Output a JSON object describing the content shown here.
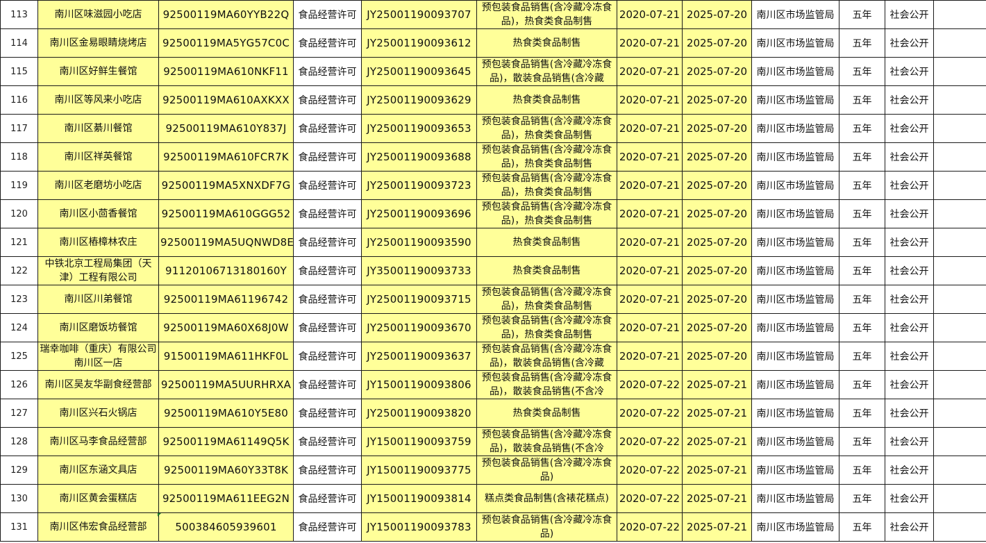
{
  "rows": [
    {
      "no": "113",
      "name": "南川区味滋园小吃店",
      "code": "92500119MA60YYB22Q",
      "type": "食品经营许可",
      "license": "JY25001190093707",
      "scope": "预包装食品销售(含冷藏冷冻食品)，热食类食品制售",
      "start": "2020-07-21",
      "end": "2025-07-20",
      "authority": "南川区市场监管局",
      "term": "五年",
      "publicity": "社会公开"
    },
    {
      "no": "114",
      "name": "南川区金易眼睛烧烤店",
      "code": "92500119MA5YG57C0C",
      "type": "食品经营许可",
      "license": "JY25001190093612",
      "scope": "热食类食品制售",
      "start": "2020-07-21",
      "end": "2025-07-20",
      "authority": "南川区市场监管局",
      "term": "五年",
      "publicity": "社会公开"
    },
    {
      "no": "115",
      "name": "南川区好鲜生餐馆",
      "code": "92500119MA610NKF11",
      "type": "食品经营许可",
      "license": "JY25001190093645",
      "scope": "预包装食品销售(含冷藏冷冻食品)，散装食品销售(含冷藏",
      "start": "2020-07-21",
      "end": "2025-07-20",
      "authority": "南川区市场监管局",
      "term": "五年",
      "publicity": "社会公开"
    },
    {
      "no": "116",
      "name": "南川区等风来小吃店",
      "code": "92500119MA610AXKXX",
      "type": "食品经营许可",
      "license": "JY25001190093629",
      "scope": "热食类食品制售",
      "start": "2020-07-21",
      "end": "2025-07-20",
      "authority": "南川区市场监管局",
      "term": "五年",
      "publicity": "社会公开"
    },
    {
      "no": "117",
      "name": "南川区綦川餐馆",
      "code": "92500119MA610Y837J",
      "type": "食品经营许可",
      "license": "JY25001190093653",
      "scope": "预包装食品销售(含冷藏冷冻食品)，热食类食品制售",
      "start": "2020-07-21",
      "end": "2025-07-20",
      "authority": "南川区市场监管局",
      "term": "五年",
      "publicity": "社会公开"
    },
    {
      "no": "118",
      "name": "南川区祥英餐馆",
      "code": "92500119MA610FCR7K",
      "type": "食品经营许可",
      "license": "JY25001190093688",
      "scope": "预包装食品销售(含冷藏冷冻食品)，热食类食品制售",
      "start": "2020-07-21",
      "end": "2025-07-20",
      "authority": "南川区市场监管局",
      "term": "五年",
      "publicity": "社会公开"
    },
    {
      "no": "119",
      "name": "南川区老磨坊小吃店",
      "code": "92500119MA5XNXDF7G",
      "type": "食品经营许可",
      "license": "JY25001190093723",
      "scope": "预包装食品销售(含冷藏冷冻食品)，热食类食品制售",
      "start": "2020-07-21",
      "end": "2025-07-20",
      "authority": "南川区市场监管局",
      "term": "五年",
      "publicity": "社会公开"
    },
    {
      "no": "120",
      "name": "南川区小茴香餐馆",
      "code": "92500119MA610GGG52",
      "type": "食品经营许可",
      "license": "JY25001190093696",
      "scope": "预包装食品销售(含冷藏冷冻食品)，热食类食品制售",
      "start": "2020-07-21",
      "end": "2025-07-20",
      "authority": "南川区市场监管局",
      "term": "五年",
      "publicity": "社会公开"
    },
    {
      "no": "121",
      "name": "南川区樁樟林农庄",
      "code": "92500119MA5UQNWD8E",
      "type": "食品经营许可",
      "license": "JY25001190093590",
      "scope": "热食类食品制售",
      "start": "2020-07-21",
      "end": "2025-07-20",
      "authority": "南川区市场监管局",
      "term": "五年",
      "publicity": "社会公开"
    },
    {
      "no": "122",
      "name": "中铁北京工程局集团（天津）工程有限公司",
      "code": "91120106713180160Y",
      "type": "食品经营许可",
      "license": "JY35001190093733",
      "scope": "热食类食品制售",
      "start": "2020-07-21",
      "end": "2025-07-20",
      "authority": "南川区市场监管局",
      "term": "五年",
      "publicity": "社会公开"
    },
    {
      "no": "123",
      "name": "南川区川弟餐馆",
      "code": "92500119MA61196742",
      "type": "食品经营许可",
      "license": "JY25001190093715",
      "scope": "预包装食品销售(含冷藏冷冻食品)，热食类食品制售",
      "start": "2020-07-21",
      "end": "2025-07-20",
      "authority": "南川区市场监管局",
      "term": "五年",
      "publicity": "社会公开"
    },
    {
      "no": "124",
      "name": "南川区磨饭坊餐馆",
      "code": "92500119MA60X68J0W",
      "type": "食品经营许可",
      "license": "JY25001190093670",
      "scope": "预包装食品销售(含冷藏冷冻食品)，热食类食品制售",
      "start": "2020-07-21",
      "end": "2025-07-20",
      "authority": "南川区市场监管局",
      "term": "五年",
      "publicity": "社会公开"
    },
    {
      "no": "125",
      "name": "瑞幸咖啡（重庆）有限公司南川区一店",
      "code": "91500119MA611HKF0L",
      "type": "食品经营许可",
      "license": "JY25001190093637",
      "scope": "预包装食品销售(含冷藏冷冻食品)，散装食品销售(含冷藏",
      "start": "2020-07-21",
      "end": "2025-07-20",
      "authority": "南川区市场监管局",
      "term": "五年",
      "publicity": "社会公开"
    },
    {
      "no": "126",
      "name": "南川区吴友华副食经营部",
      "code": "92500119MA5UURHRXA",
      "type": "食品经营许可",
      "license": "JY15001190093806",
      "scope": "预包装食品销售(含冷藏冷冻食品)，散装食品销售(不含冷",
      "start": "2020-07-22",
      "end": "2025-07-21",
      "authority": "南川区市场监管局",
      "term": "五年",
      "publicity": "社会公开"
    },
    {
      "no": "127",
      "name": "南川区兴石火锅店",
      "code": "92500119MA610Y5E80",
      "type": "食品经营许可",
      "license": "JY25001190093820",
      "scope": "热食类食品制售",
      "start": "2020-07-22",
      "end": "2025-07-21",
      "authority": "南川区市场监管局",
      "term": "五年",
      "publicity": "社会公开"
    },
    {
      "no": "128",
      "name": "南川区马李食品经营部",
      "code": "92500119MA61149Q5K",
      "type": "食品经营许可",
      "license": "JY15001190093759",
      "scope": "预包装食品销售(含冷藏冷冻食品)，散装食品销售(不含冷",
      "start": "2020-07-22",
      "end": "2025-07-21",
      "authority": "南川区市场监管局",
      "term": "五年",
      "publicity": "社会公开"
    },
    {
      "no": "129",
      "name": "南川区东涵文具店",
      "code": "92500119MA60Y33T8K",
      "type": "食品经营许可",
      "license": "JY15001190093775",
      "scope": "预包装食品销售(含冷藏冷冻食品)",
      "start": "2020-07-22",
      "end": "2025-07-21",
      "authority": "南川区市场监管局",
      "term": "五年",
      "publicity": "社会公开"
    },
    {
      "no": "130",
      "name": "南川区黄会蛋糕店",
      "code": "92500119MA611EEG2N",
      "type": "食品经营许可",
      "license": "JY15001190093814",
      "scope": "糕点类食品制售(含裱花糕点)",
      "start": "2020-07-22",
      "end": "2025-07-21",
      "authority": "南川区市场监管局",
      "term": "五年",
      "publicity": "社会公开"
    },
    {
      "no": "131",
      "name": "南川区伟宏食品经营部",
      "code": "500384605939601",
      "type": "食品经营许可",
      "license": "JY15001190093783",
      "scope": "预包装食品销售(含冷藏冷冻食品)",
      "start": "2020-07-22",
      "end": "2025-07-21",
      "authority": "南川区市场监管局",
      "term": "五年",
      "publicity": "社会公开"
    }
  ]
}
